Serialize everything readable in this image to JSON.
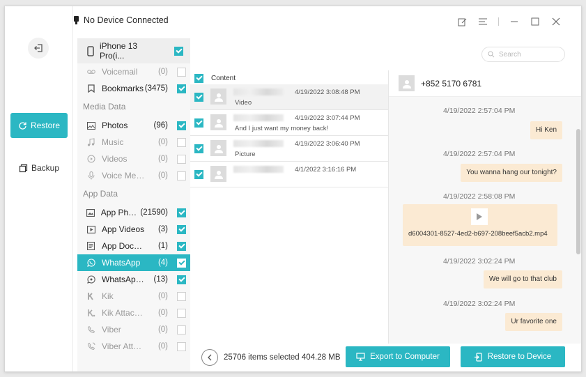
{
  "header": {
    "device_status": "No Device Connected",
    "controls": [
      "edit-icon",
      "menu-icon",
      "minimize-icon",
      "maximize-icon",
      "close-icon"
    ]
  },
  "nav": {
    "restore_label": "Restore",
    "backup_label": "Backup"
  },
  "sidebar": {
    "device_name": "iPhone 13 Pro(i...",
    "items_top": [
      {
        "label": "Voicemail",
        "count": "(0)",
        "icon": "voicemail-icon",
        "checked": false,
        "disabled": true
      },
      {
        "label": "Bookmarks",
        "count": "(3475)",
        "icon": "bookmark-icon",
        "checked": true,
        "disabled": false
      }
    ],
    "media_header": "Media Data",
    "media_items": [
      {
        "label": "Photos",
        "count": "(96)",
        "icon": "photo-icon",
        "checked": true,
        "disabled": false
      },
      {
        "label": "Music",
        "count": "(0)",
        "icon": "music-icon",
        "checked": false,
        "disabled": true
      },
      {
        "label": "Videos",
        "count": "(0)",
        "icon": "video-icon",
        "checked": false,
        "disabled": true
      },
      {
        "label": "Voice Memos",
        "count": "(0)",
        "icon": "microphone-icon",
        "checked": false,
        "disabled": true
      }
    ],
    "app_header": "App Data",
    "app_items": [
      {
        "label": "App Phot...",
        "count": "(21590)",
        "icon": "app-photo-icon",
        "checked": true,
        "disabled": false
      },
      {
        "label": "App Videos",
        "count": "(3)",
        "icon": "app-video-icon",
        "checked": true,
        "disabled": false
      },
      {
        "label": "App Docume...",
        "count": "(1)",
        "icon": "app-document-icon",
        "checked": true,
        "disabled": false
      },
      {
        "label": "WhatsApp",
        "count": "(4)",
        "icon": "whatsapp-icon",
        "checked": true,
        "disabled": false,
        "active": true
      },
      {
        "label": "WhatsApp At...",
        "count": "(13)",
        "icon": "whatsapp-attachment-icon",
        "checked": true,
        "disabled": false
      },
      {
        "label": "Kik",
        "count": "(0)",
        "icon": "kik-icon",
        "checked": false,
        "disabled": true
      },
      {
        "label": "Kik Attachme...",
        "count": "(0)",
        "icon": "kik-attachment-icon",
        "checked": false,
        "disabled": true
      },
      {
        "label": "Viber",
        "count": "(0)",
        "icon": "viber-icon",
        "checked": false,
        "disabled": true
      },
      {
        "label": "Viber Attachm...",
        "count": "(0)",
        "icon": "viber-attachment-icon",
        "checked": false,
        "disabled": true
      }
    ]
  },
  "content_list": {
    "header": "Content",
    "rows": [
      {
        "time": "4/19/2022 3:08:48 PM",
        "preview": "Video",
        "selected": true
      },
      {
        "time": "4/19/2022 3:07:44 PM",
        "preview": "And I just want my money back!",
        "selected": false
      },
      {
        "time": "4/19/2022 3:06:40 PM",
        "preview": "Picture",
        "selected": false
      },
      {
        "time": "4/1/2022 3:16:16 PM",
        "preview": "",
        "selected": false
      }
    ]
  },
  "search": {
    "placeholder": "Search"
  },
  "chat": {
    "contact": "+852 5170 6781",
    "messages": [
      {
        "time": "4/19/2022 2:57:04 PM",
        "text": "Hi Ken"
      },
      {
        "time": "4/19/2022 2:57:04 PM",
        "text": "You wanna hang our tonight?"
      },
      {
        "time": "4/19/2022 2:58:08 PM",
        "file": "d6004301-8527-4ed2-b697-208beef5acb2.mp4"
      },
      {
        "time": "4/19/2022 3:02:24 PM",
        "text": "We will go to that club"
      },
      {
        "time": "4/19/2022 3:02:24 PM",
        "text": "Ur favorite one"
      }
    ]
  },
  "footer": {
    "selection_info": "25706 items selected 404.28 MB",
    "export_label": "Export to Computer",
    "restore_label": "Restore to Device"
  },
  "colors": {
    "accent": "#2bb7c3",
    "bubble": "#fbead3"
  }
}
